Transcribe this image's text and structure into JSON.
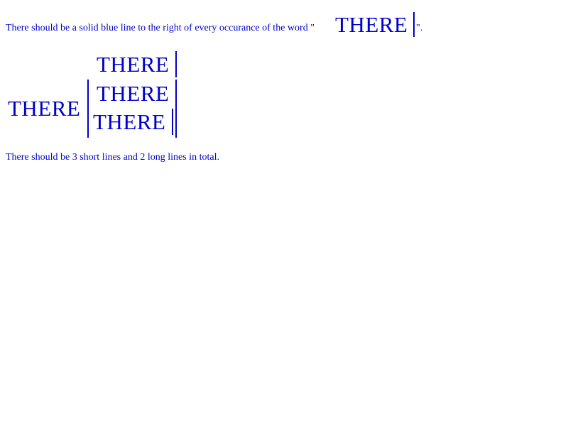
{
  "intro": {
    "prefix": "There should be a solid blue line to the right of every occurance of the word \"",
    "word": "THERE",
    "suffix": "\"."
  },
  "test": {
    "top_word": "THERE",
    "left_word": "THERE",
    "middle_word": "THERE",
    "bottom_word": "THERE"
  },
  "footer": {
    "text": "There should be 3 short lines and 2 long lines in total."
  }
}
